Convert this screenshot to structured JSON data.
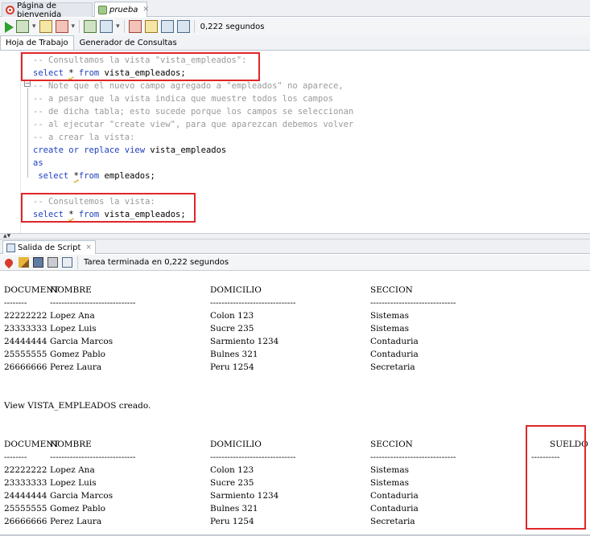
{
  "tabs": [
    {
      "label": "Página de bienvenida",
      "icon": "oracle-icon"
    },
    {
      "label": "prueba",
      "icon": "sql-worksheet-icon"
    }
  ],
  "toolbar": {
    "icons": [
      "run-statement-icon",
      "run-script-icon",
      "commit-icon",
      "rollback-icon",
      "autotrace-icon",
      "explain-plan-icon",
      "sql-tuning-icon",
      "clear-icon",
      "history-icon",
      "timer-icon"
    ],
    "elapsed": "0,222 segundos"
  },
  "subtabs": [
    "Hoja de Trabajo",
    "Generador de Consultas"
  ],
  "editor": {
    "lines": [
      {
        "text": "-- Consultamos la vista \"vista_empleados\":",
        "type": "comment"
      },
      {
        "text": "select * from vista_empleados;",
        "type": "sql"
      },
      {
        "text": "-- Note que el nuevo campo agregado a \"empleados\" no aparece,",
        "type": "comment"
      },
      {
        "text": "-- a pesar que la vista indica que muestre todos los campos",
        "type": "comment"
      },
      {
        "text": "-- de dicha tabla; esto sucede porque los campos se seleccionan",
        "type": "comment"
      },
      {
        "text": "-- al ejecutar \"create view\", para que aparezcan debemos volver",
        "type": "comment"
      },
      {
        "text": "-- a crear la vista:",
        "type": "comment"
      },
      {
        "text": "create or replace view vista_empleados",
        "type": "sql"
      },
      {
        "text": "as",
        "type": "sql"
      },
      {
        "text": " select *from empleados;",
        "type": "sql"
      },
      {
        "text": "",
        "type": "blank"
      },
      {
        "text": "-- Consultemos la vista:",
        "type": "comment"
      },
      {
        "text": "select * from vista_empleados;",
        "type": "sql"
      }
    ]
  },
  "output_tab": {
    "label": "Salida de Script",
    "close": "×"
  },
  "output_toolbar": {
    "status": "Tarea terminada en 0,222 segundos"
  },
  "result1": {
    "headers": [
      "DOCUMENT",
      "NOMBRE",
      "DOMICILIO",
      "SECCION"
    ],
    "separators": [
      "--------",
      "------------------------------",
      "------------------------------",
      "------------------------------"
    ],
    "rows": [
      [
        "22222222",
        "Lopez Ana",
        "Colon 123",
        "Sistemas"
      ],
      [
        "23333333",
        "Lopez Luis",
        "Sucre 235",
        "Sistemas"
      ],
      [
        "24444444",
        "Garcia Marcos",
        "Sarmiento 1234",
        "Contaduria"
      ],
      [
        "25555555",
        "Gomez Pablo",
        "Bulnes 321",
        "Contaduria"
      ],
      [
        "26666666",
        "Perez Laura",
        "Peru 1254",
        "Secretaria"
      ]
    ]
  },
  "view_message": "View VISTA_EMPLEADOS creado.",
  "result2": {
    "headers": [
      "DOCUMENT",
      "NOMBRE",
      "DOMICILIO",
      "SECCION",
      "SUELDO"
    ],
    "separators": [
      "--------",
      "------------------------------",
      "------------------------------",
      "------------------------------",
      "----------"
    ],
    "rows": [
      [
        "22222222",
        "Lopez Ana",
        "Colon 123",
        "Sistemas",
        ""
      ],
      [
        "23333333",
        "Lopez Luis",
        "Sucre 235",
        "Sistemas",
        ""
      ],
      [
        "24444444",
        "Garcia Marcos",
        "Sarmiento 1234",
        "Contaduria",
        ""
      ],
      [
        "25555555",
        "Gomez Pablo",
        "Bulnes 321",
        "Contaduria",
        ""
      ],
      [
        "26666666",
        "Perez Laura",
        "Peru 1254",
        "Secretaria",
        ""
      ]
    ]
  },
  "colors": {
    "highlight_box": "#e0262a",
    "comment": "#9a9a9a",
    "keyword": "#1f3fbf"
  }
}
